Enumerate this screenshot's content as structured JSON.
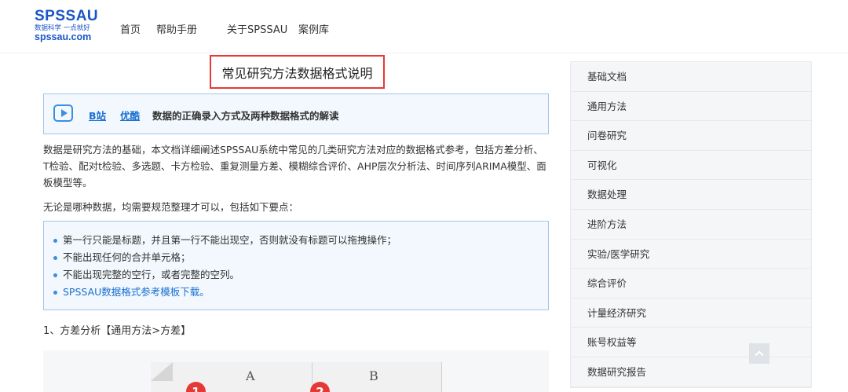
{
  "brand": {
    "name": "SPSSAU",
    "slogan": "数据科学 一点就好",
    "url": "spssau.com"
  },
  "nav": [
    "首页",
    "帮助手册",
    "关于SPSSAU",
    "案例库"
  ],
  "article": {
    "title": "常见研究方法数据格式说明",
    "video": {
      "link1": "B站",
      "link2": "优酷",
      "desc": "数据的正确录入方式及两种数据格式的解读"
    },
    "intro": "数据是研究方法的基础，本文档详细阐述SPSSAU系统中常见的几类研究方法对应的数据格式参考，包括方差分析、T检验、配对t检验、多选题、卡方检验、重复测量方差、模糊综合评价、AHP层次分析法、时间序列ARIMA模型、面板模型等。",
    "rule_intro": "无论是哪种数据，均需要规范整理才可以，包括如下要点：",
    "tips": [
      "第一行只能是标题，并且第一行不能出现空，否则就没有标题可以拖拽操作；",
      "不能出现任何的合并单元格；",
      "不能出现完整的空行，或者完整的空列。",
      "SPSSAU数据格式参考模板下载。"
    ],
    "section1": "1、方差分析【通用方法>方差】",
    "excel": {
      "col_a": "A",
      "col_b": "B",
      "badge1": "1",
      "badge2": "2"
    }
  },
  "sidebar": [
    "基础文档",
    "通用方法",
    "问卷研究",
    "可视化",
    "数据处理",
    "进阶方法",
    "实验/医学研究",
    "综合评价",
    "计量经济研究",
    "账号权益等",
    "数据研究报告"
  ],
  "colors": {
    "brand": "#1a56c8",
    "highlight_border": "#e53935",
    "info_bg": "#f2f8fd",
    "link": "#1a6fd1"
  }
}
